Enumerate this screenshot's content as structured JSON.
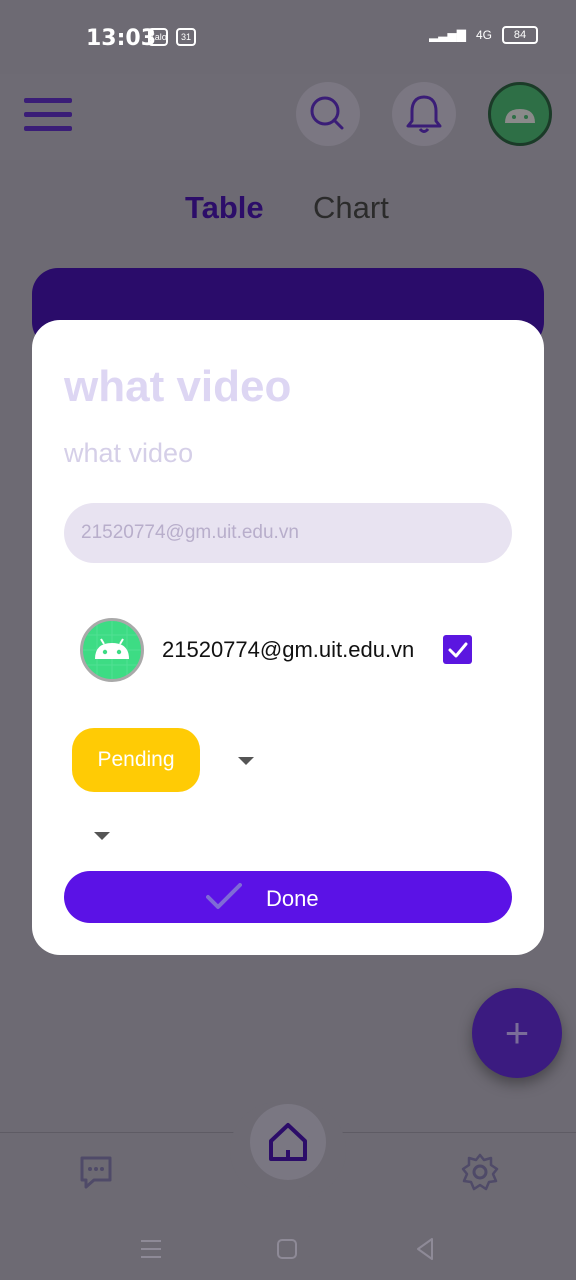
{
  "status_bar": {
    "time": "13:03",
    "badge1": "Zalo",
    "badge2": "31",
    "network": "4G",
    "battery": "84"
  },
  "tabs": {
    "table": "Table",
    "chart": "Chart"
  },
  "dialog": {
    "title": "what video",
    "subtitle": "what video",
    "email_placeholder": "21520774@gm.uit.edu.vn",
    "member_email": "21520774@gm.uit.edu.vn",
    "member_checked": true,
    "status": "Pending",
    "done_label": "Done"
  },
  "colors": {
    "accent": "#5b12e6",
    "pending": "#ffcb05",
    "overlay": "#6d6a73"
  },
  "icons": [
    "menu-icon",
    "search-icon",
    "bell-icon",
    "android-avatar-icon",
    "check-icon",
    "chevron-down-icon",
    "plus-icon",
    "home-icon",
    "chat-icon",
    "gear-icon"
  ]
}
